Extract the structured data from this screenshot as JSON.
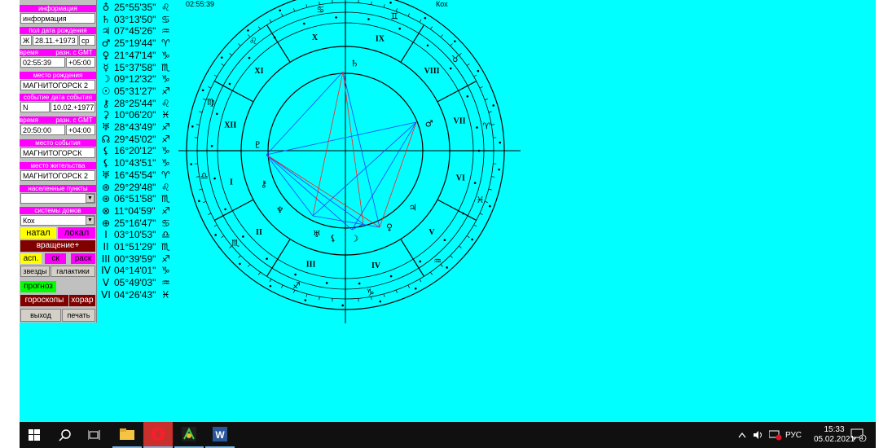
{
  "panel": {
    "info_header": "информация",
    "info_value": "информация",
    "birth_header": "пол дата рождения",
    "sex": "Ж",
    "birth_date": "28.11.+1973",
    "birth_weekday": "ср",
    "time_header_1": "время",
    "gmt_header_1": "разн. с GMT",
    "birth_time": "02:55:39",
    "birth_gmt": "+05:00",
    "birthplace_header": "место рождения",
    "birthplace": "МАГНИТОГОРСК 2",
    "event_header": "событие дата события",
    "event_code": "N",
    "event_date": "10.02.+1977",
    "time_header_2": "время",
    "gmt_header_2": "разн. с GMT",
    "event_time": "20:50:00",
    "event_gmt": "+04:00",
    "eventplace_header": "место события",
    "eventplace": "МАГНИТОГОРСК",
    "residence_header": "место жительства",
    "residence": "МАГНИТОГОРСК 2",
    "settlements_header": "населенные пункты",
    "settlements_value": "",
    "houses_header": "системы домов",
    "houses_value": "Кох",
    "btn_natal": "натал",
    "btn_local": "локал",
    "btn_rotation": "вращение+",
    "btn_asp": "асп.",
    "btn_sk": "ск",
    "btn_rask": "раск",
    "btn_stars": "звезды",
    "btn_galaxies": "галактики",
    "btn_forecast": "прогноз",
    "btn_horoscopes": "гороскопы",
    "btn_horar": "хорар",
    "btn_exit": "выход",
    "btn_print": "печать"
  },
  "planets": [
    {
      "glyph": "♁",
      "value": "25°55'35\"",
      "sign": "♌"
    },
    {
      "glyph": "♄",
      "value": "03°13'50\"",
      "sign": "♋"
    },
    {
      "glyph": "♃",
      "value": "07°45'26\"",
      "sign": "♒"
    },
    {
      "glyph": "♂",
      "value": "25°19'44\"",
      "sign": "♈"
    },
    {
      "glyph": "♀",
      "value": "21°47'14\"",
      "sign": "♑"
    },
    {
      "glyph": "☿",
      "value": "15°37'58\"",
      "sign": "♏"
    },
    {
      "glyph": "☽",
      "value": "09°12'32\"",
      "sign": "♑"
    },
    {
      "glyph": "☉",
      "value": "05°31'27\"",
      "sign": "♐"
    },
    {
      "glyph": "⚷",
      "value": "28°25'44\"",
      "sign": "♌"
    },
    {
      "glyph": "⚳",
      "value": "10°06'20\"",
      "sign": "♓"
    },
    {
      "glyph": "♅",
      "value": "28°43'49\"",
      "sign": "♐"
    },
    {
      "glyph": "☊",
      "value": "29°45'02\"",
      "sign": "♐"
    },
    {
      "glyph": "⚸",
      "value": "16°20'12\"",
      "sign": "♑"
    },
    {
      "glyph": "⚸",
      "value": "10°43'51\"",
      "sign": "♑"
    },
    {
      "glyph": "♅",
      "value": "16°45'54\"",
      "sign": "♈"
    },
    {
      "glyph": "⊛",
      "value": "29°29'48\"",
      "sign": "♌"
    },
    {
      "glyph": "⊛",
      "value": "06°51'58\"",
      "sign": "♏"
    },
    {
      "glyph": "⊗",
      "value": "11°04'59\"",
      "sign": "♐"
    },
    {
      "glyph": "⊕",
      "value": "25°16'47\"",
      "sign": "♋"
    },
    {
      "glyph": "I",
      "value": "03°10'53\"",
      "sign": "♎"
    },
    {
      "glyph": "II",
      "value": "01°51'29\"",
      "sign": "♏"
    },
    {
      "glyph": "III",
      "value": "00°39'59\"",
      "sign": "♐"
    },
    {
      "glyph": "IV",
      "value": "04°14'01\"",
      "sign": "♑"
    },
    {
      "glyph": "V",
      "value": "05°49'03\"",
      "sign": "♒"
    },
    {
      "glyph": "VI",
      "value": "04°26'43\"",
      "sign": "♓"
    }
  ],
  "chart": {
    "time_label": "02:55:39",
    "house_system_label": "Кох",
    "house_numerals": [
      "I",
      "II",
      "III",
      "IV",
      "V",
      "VI",
      "VII",
      "VIII",
      "IX",
      "X",
      "XI",
      "XII"
    ]
  },
  "taskbar": {
    "lang": "РУС",
    "time": "15:33",
    "date": "05.02.2021",
    "notif_count": "4"
  }
}
